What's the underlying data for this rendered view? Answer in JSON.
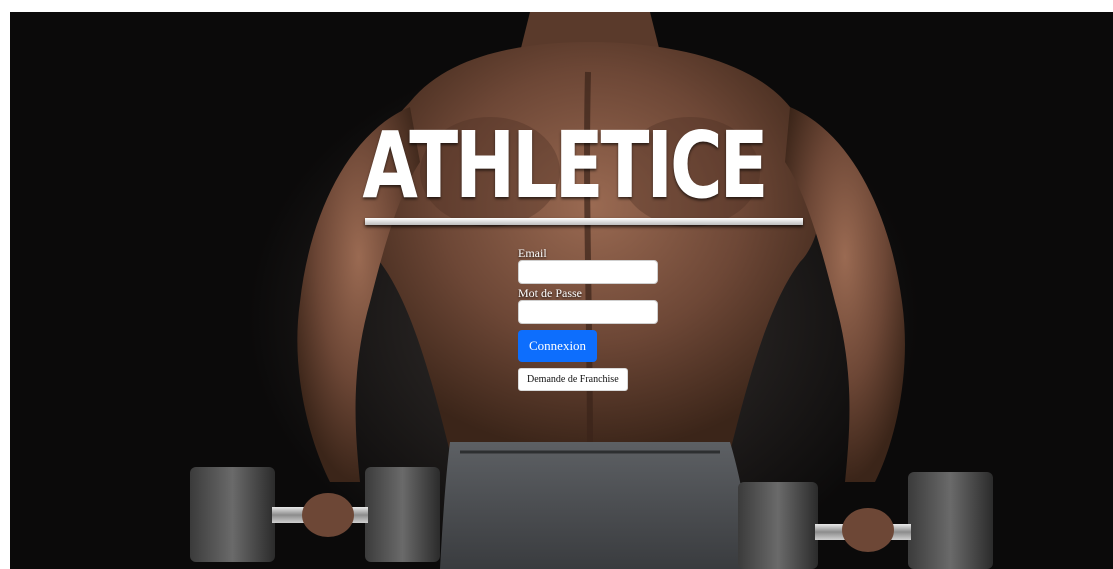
{
  "brand": {
    "title": "ATHLETICE"
  },
  "login": {
    "email_label": "Email",
    "email_value": "",
    "password_label": "Mot de Passe",
    "password_value": "",
    "submit_label": "Connexion",
    "franchise_label": "Demande de Franchise"
  },
  "colors": {
    "primary_button": "#0d6efd",
    "title_text": "#ffffff",
    "background": "#0b0a0a"
  },
  "images": {
    "background": "muscular-athlete-back-with-dumbbells"
  }
}
